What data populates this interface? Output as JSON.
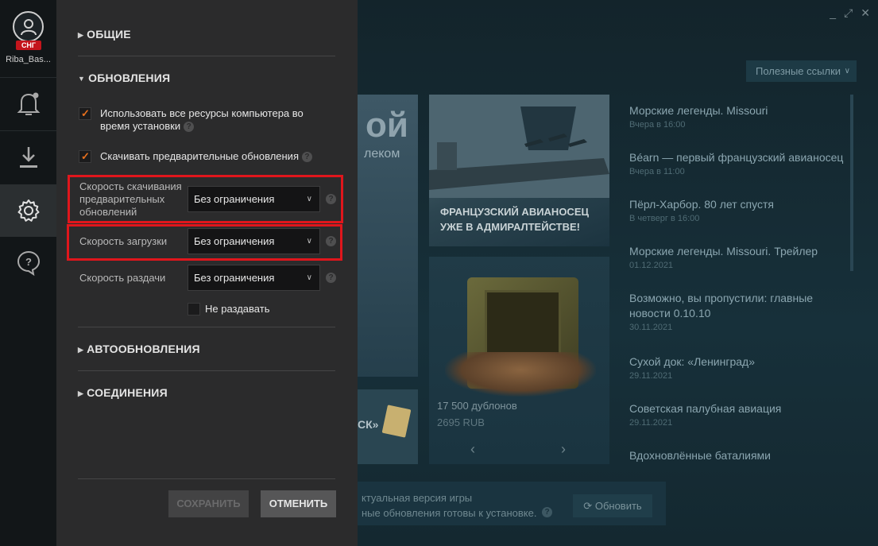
{
  "profile": {
    "username": "Riba_Bas...",
    "region_badge": "СНГ"
  },
  "window_controls": {
    "minimize": "_",
    "maximize": "⤢",
    "close": "✕"
  },
  "settings": {
    "sections": {
      "general": "ОБЩИЕ",
      "updates": "ОБНОВЛЕНИЯ",
      "autoupdates": "АВТООБНОВЛЕНИЯ",
      "connections": "СОЕДИНЕНИЯ"
    },
    "use_all_resources": {
      "label_line1": "Использовать все ресурсы компьютера во",
      "label_line2": "время установки",
      "checked": true
    },
    "download_preupdates": {
      "label": "Скачивать предварительные обновления",
      "checked": true
    },
    "preupdate_speed": {
      "label_line1": "Скорость скачивания",
      "label_line2": "предварительных",
      "label_line3": "обновлений",
      "value": "Без ограничения"
    },
    "download_speed": {
      "label": "Скорость загрузки",
      "value": "Без ограничения"
    },
    "seed_speed": {
      "label": "Скорость раздачи",
      "value": "Без ограничения"
    },
    "no_seed": {
      "label": "Не раздавать",
      "checked": false
    },
    "help_glyph": "?",
    "save_label": "СОХРАНИТЬ",
    "cancel_label": "ОТМЕНИТЬ"
  },
  "background": {
    "links_dropdown": "Полезные ссылки",
    "promo_partial_big": "ой",
    "promo_partial_small": "леком",
    "promo_partial_bottom": "СК»",
    "card_carrier_line1": "ФРАНЦУЗСКИЙ АВИАНОСЕЦ",
    "card_carrier_line2": "УЖЕ В АДМИРАЛТЕЙСТВЕ!",
    "card_safe_price1": "17 500 дублонов",
    "card_safe_price2": "2695 RUB",
    "news": [
      {
        "title": "Морские легенды. Missouri",
        "date": "Вчера в 16:00"
      },
      {
        "title": "Béarn — первый французский авианосец",
        "date": "Вчера в 11:00"
      },
      {
        "title": "Пёрл-Харбор. 80 лет спустя",
        "date": "В четверг в 16:00"
      },
      {
        "title": "Морские легенды. Missouri. Трейлер",
        "date": "01.12.2021"
      },
      {
        "title": "Возможно, вы пропустили: главные новости 0.10.10",
        "date": "30.11.2021"
      },
      {
        "title": "Сухой док: «Ленинград»",
        "date": "29.11.2021"
      },
      {
        "title": "Советская палубная авиация",
        "date": "29.11.2021"
      },
      {
        "title": "Вдохновлённые баталиями",
        "date": ""
      }
    ],
    "status_line1": "ктуальная версия игры",
    "status_line2": "ные обновления готовы к установке.",
    "refresh_label": "Обновить"
  },
  "colors": {
    "accent_orange": "#e8701d",
    "highlight_red": "#e0161c",
    "region_red": "#c4151c"
  },
  "icons": [
    "user-icon",
    "bell-icon",
    "download-icon",
    "gear-icon",
    "help-icon",
    "refresh-icon"
  ]
}
